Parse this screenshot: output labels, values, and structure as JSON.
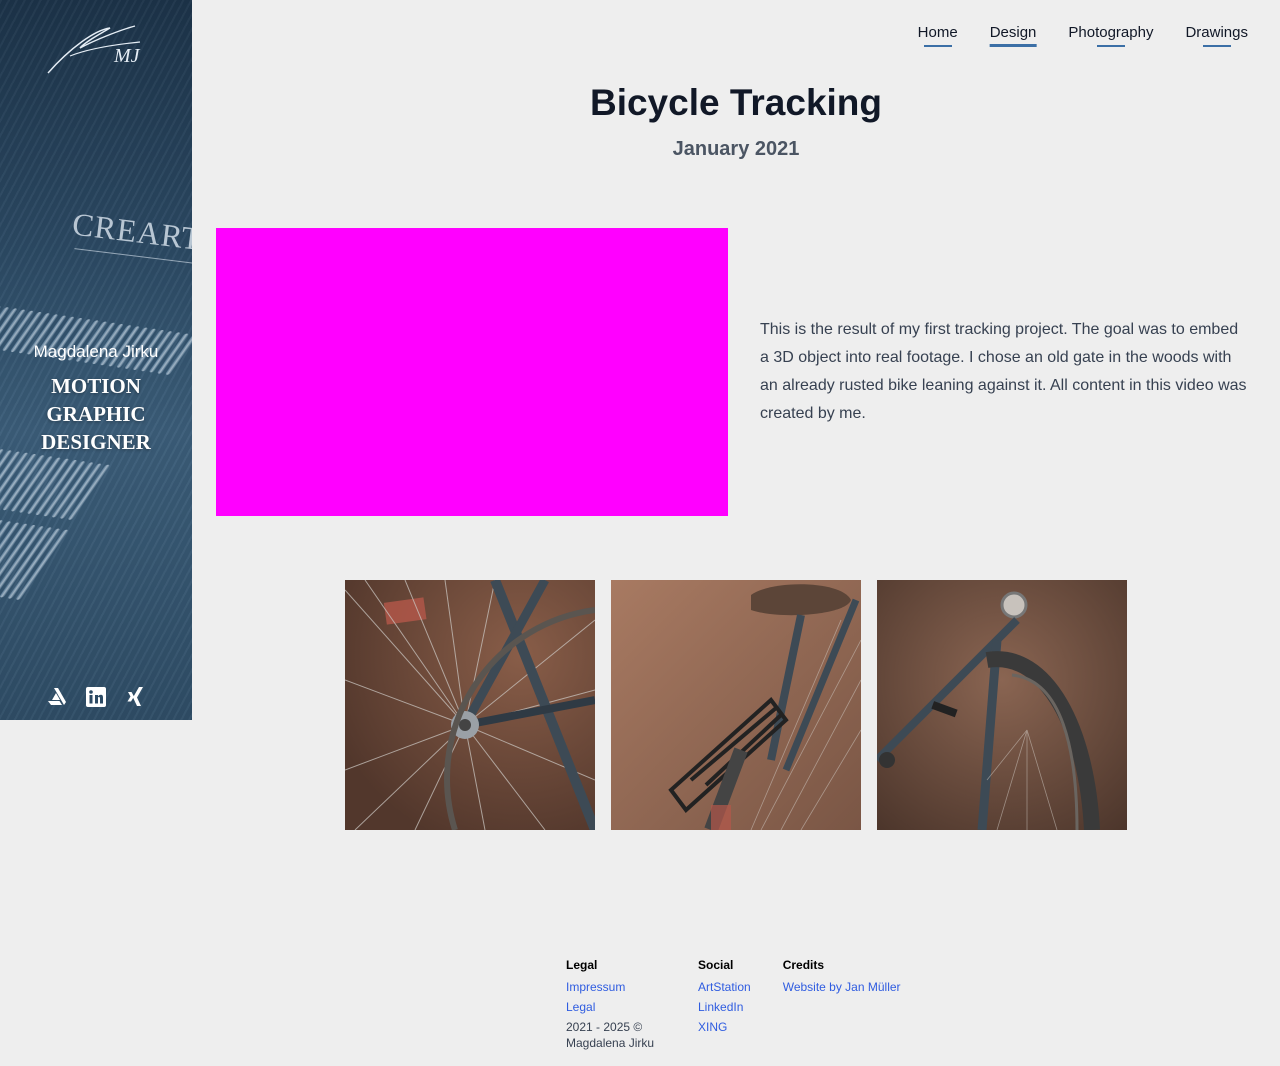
{
  "sidebar": {
    "signature_text": "MJ",
    "brand_mark": "CREARTI",
    "name": "Magdalena Jirku",
    "role": "MOTION GRAPHIC DESIGNER",
    "social_icons": [
      "artstation-icon",
      "linkedin-icon",
      "xing-icon"
    ]
  },
  "nav": {
    "items": [
      {
        "label": "Home"
      },
      {
        "label": "Design",
        "active": true
      },
      {
        "label": "Photography"
      },
      {
        "label": "Drawings"
      }
    ]
  },
  "project": {
    "title": "Bicycle Tracking",
    "date": "January 2021",
    "description": "This is the result of my first tracking project. The goal was to embed a 3D object into real footage. I chose an old gate in the woods with an already rusted bike leaning against it. All content in this video was created by me."
  },
  "gallery": {
    "images": [
      "bicycle-rear-wheel",
      "bicycle-saddle-rack",
      "bicycle-front-fender"
    ]
  },
  "footer": {
    "legal": {
      "heading": "Legal",
      "links": [
        "Impressum",
        "Legal"
      ],
      "copyright": "2021 - 2025 © Magdalena Jirku"
    },
    "social": {
      "heading": "Social",
      "links": [
        "ArtStation",
        "LinkedIn",
        "XING"
      ]
    },
    "credits": {
      "heading": "Credits",
      "links": [
        "Website by Jan Müller"
      ]
    }
  },
  "colors": {
    "background": "#eeeeee",
    "nav_underline": "#3b6fa6",
    "video_placeholder": "#ff00ff",
    "link": "#2f5ce0"
  }
}
